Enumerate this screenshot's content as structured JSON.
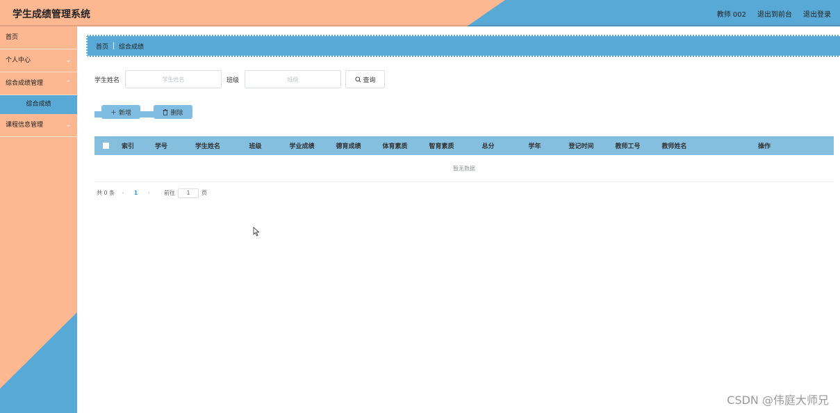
{
  "header": {
    "title": "学生成绩管理系统",
    "user": "教师 002",
    "front_link": "退出到前台",
    "logout": "退出登录"
  },
  "sidebar": {
    "items": [
      {
        "label": "首页",
        "has_children": false
      },
      {
        "label": "个人中心",
        "has_children": true
      },
      {
        "label": "综合成绩管理",
        "has_children": true,
        "expanded": true
      },
      {
        "label": "课程信息管理",
        "has_children": true
      }
    ],
    "active_sub": "综合成绩"
  },
  "breadcrumb": {
    "home": "首页",
    "current": "综合成绩"
  },
  "search": {
    "student_name_label": "学生姓名",
    "student_name_placeholder": "学生姓名",
    "class_label": "班级",
    "class_placeholder": "班级",
    "query_label": "查询"
  },
  "actions": {
    "add_label": "新增",
    "delete_label": "删除"
  },
  "table": {
    "columns": [
      "索引",
      "学号",
      "学生姓名",
      "班级",
      "学业成绩",
      "德育成绩",
      "体育素质",
      "智育素质",
      "总分",
      "学年",
      "登记时间",
      "教师工号",
      "教师姓名",
      "操作"
    ],
    "empty_text": "暂无数据"
  },
  "pagination": {
    "total_text": "共 0 条",
    "current_page": "1",
    "goto_label": "前往",
    "goto_value": "1",
    "page_suffix": "页"
  },
  "watermark": "CSDN @伟庭大师兄",
  "colors": {
    "peach": "#fdb892",
    "blue": "#58a9d6",
    "table_header": "#84bfe0"
  }
}
